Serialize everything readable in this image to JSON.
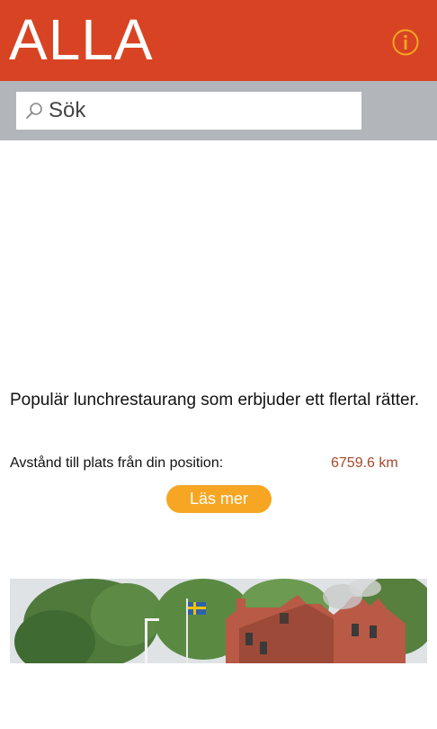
{
  "header": {
    "title": "ALLA",
    "info_icon": "info-circle-icon",
    "background_color": "#d84423",
    "info_icon_color": "#f6a623"
  },
  "search": {
    "placeholder": "Sök",
    "value": "",
    "icon": "search-icon"
  },
  "place": {
    "description": "Populär lunchrestaurang som erbjuder ett flertal rätter.",
    "distance_label": "Avstånd till plats från din position:",
    "distance_value": "6759.6 km",
    "distance_color": "#a7472a",
    "read_more_label": "Läs mer",
    "read_more_color": "#f6a623"
  }
}
